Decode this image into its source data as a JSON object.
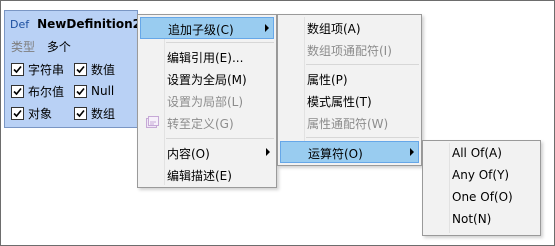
{
  "node": {
    "badge": "Def",
    "name": "NewDefinition2",
    "type_label": "类型",
    "type_value": "多个",
    "checks": [
      {
        "label": "字符串"
      },
      {
        "label": "数值"
      },
      {
        "label": "布尔值"
      },
      {
        "label": "Null"
      },
      {
        "label": "对象"
      },
      {
        "label": "数组"
      }
    ]
  },
  "menu1": {
    "items": [
      {
        "label": "追加子级(C)",
        "state": "highlighted",
        "submenu": true
      },
      {
        "label": "编辑引用(E)..."
      },
      {
        "label": "设置为全局(M)"
      },
      {
        "label": "设置为局部(L)",
        "state": "disabled"
      },
      {
        "label": "转至定义(G)",
        "state": "disabled"
      },
      {
        "label": "内容(O)",
        "submenu": true
      },
      {
        "label": "编辑描述(E)"
      }
    ]
  },
  "menu2": {
    "items": [
      {
        "label": "数组项(A)"
      },
      {
        "label": "数组项通配符(I)",
        "state": "disabled"
      },
      {
        "label": "属性(P)"
      },
      {
        "label": "模式属性(T)"
      },
      {
        "label": "属性通配符(W)",
        "state": "disabled"
      },
      {
        "label": "运算符(O)",
        "state": "highlighted",
        "submenu": true
      }
    ]
  },
  "menu3": {
    "items": [
      {
        "label": "All Of(A)"
      },
      {
        "label": "Any Of(Y)"
      },
      {
        "label": "One Of(O)"
      },
      {
        "label": "Not(N)"
      }
    ]
  }
}
